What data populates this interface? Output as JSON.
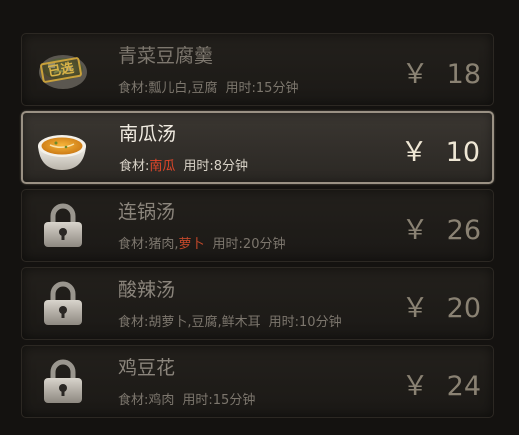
{
  "dishes": [
    {
      "name": "青菜豆腐羹",
      "ingredients_label": "食材:",
      "ingredients": [
        {
          "text": "瓢儿白,豆腐",
          "highlight": false
        }
      ],
      "time": "用时:15分钟",
      "currency": "￥",
      "price": "18",
      "state": "chosen",
      "stamp": "已选",
      "icon": "tofu-soup-bowl-icon"
    },
    {
      "name": "南瓜汤",
      "ingredients_label": "食材:",
      "ingredients": [
        {
          "text": "南瓜",
          "highlight": true
        }
      ],
      "time": "用时:8分钟",
      "currency": "￥",
      "price": "10",
      "state": "selected",
      "icon": "pumpkin-soup-bowl-icon"
    },
    {
      "name": "连锅汤",
      "ingredients_label": "食材:",
      "ingredients": [
        {
          "text": "猪肉,",
          "highlight": false
        },
        {
          "text": "萝卜",
          "highlight": true
        }
      ],
      "time": "用时:20分钟",
      "currency": "￥",
      "price": "26",
      "state": "locked",
      "icon": "padlock-icon"
    },
    {
      "name": "酸辣汤",
      "ingredients_label": "食材:",
      "ingredients": [
        {
          "text": "胡萝卜,豆腐,鲜木耳",
          "highlight": false
        }
      ],
      "time": "用时:10分钟",
      "currency": "￥",
      "price": "20",
      "state": "locked",
      "icon": "padlock-icon"
    },
    {
      "name": "鸡豆花",
      "ingredients_label": "食材:",
      "ingredients": [
        {
          "text": "鸡肉",
          "highlight": false
        }
      ],
      "time": "用时:15分钟",
      "currency": "￥",
      "price": "24",
      "state": "locked",
      "icon": "padlock-icon"
    }
  ],
  "colors": {
    "highlight_ingredient": "#e0462a",
    "selected_border": "#9a9184",
    "stamp": "#c9a13a"
  }
}
